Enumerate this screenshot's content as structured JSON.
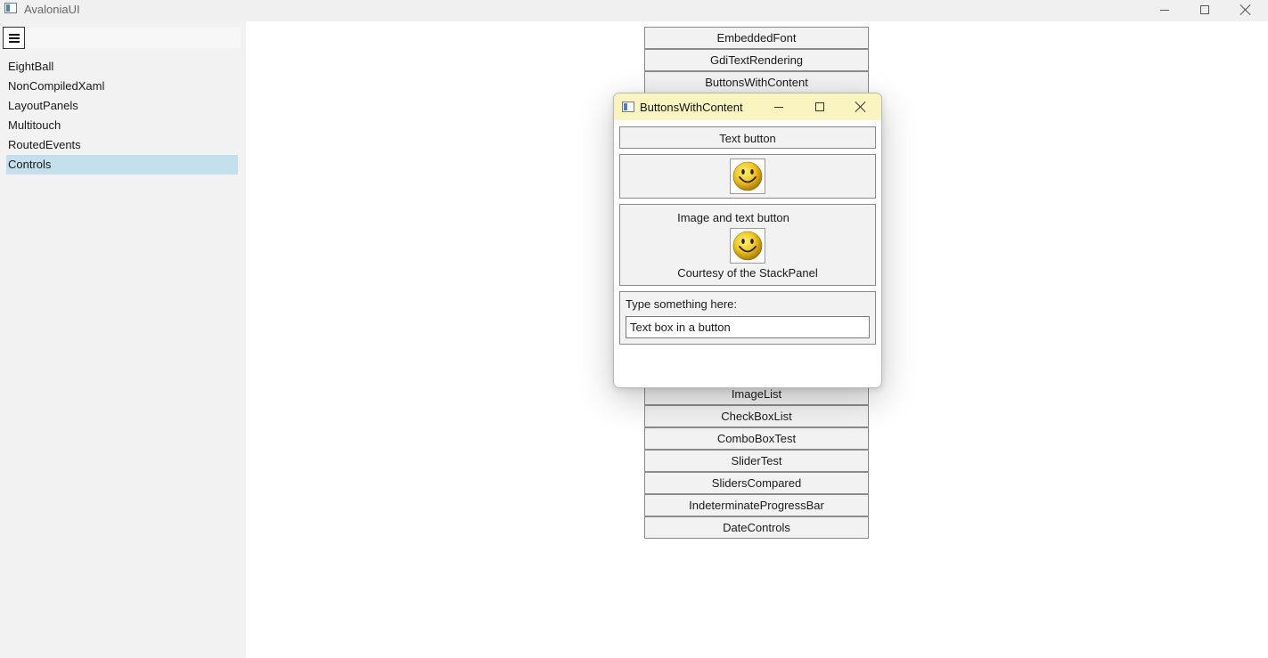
{
  "window": {
    "title": "AvaloniaUI",
    "icon": "app-window-icon",
    "controls": [
      "minimize-icon",
      "maximize-icon",
      "close-icon"
    ]
  },
  "sidebar": {
    "menu_icon": "hamburger-icon",
    "items": [
      {
        "label": "EightBall",
        "selected": false
      },
      {
        "label": "NonCompiledXaml",
        "selected": false
      },
      {
        "label": "LayoutPanels",
        "selected": false
      },
      {
        "label": "Multitouch",
        "selected": false
      },
      {
        "label": "RoutedEvents",
        "selected": false
      },
      {
        "label": "Controls",
        "selected": true
      }
    ]
  },
  "demos": {
    "items": [
      "EmbeddedFont",
      "GdiTextRendering",
      "ButtonsWithContent",
      "ImageList",
      "CheckBoxList",
      "ComboBoxTest",
      "SliderTest",
      "SlidersCompared",
      "IndeterminateProgressBar",
      "DateControls"
    ]
  },
  "dialog": {
    "title": "ButtonsWithContent",
    "text_button": "Text button",
    "image_text_button": {
      "top": "Image and text button",
      "bottom": "Courtesy of the StackPanel"
    },
    "textbox_button": {
      "prompt": "Type something here:",
      "value": "Text box in a button"
    }
  },
  "colors": {
    "dialog_title_bg": "#faf5c0",
    "selected_item_bg": "#c5e0ed",
    "sidebar_bg": "#f2f2f2",
    "button_bg": "#f2f2f2"
  }
}
